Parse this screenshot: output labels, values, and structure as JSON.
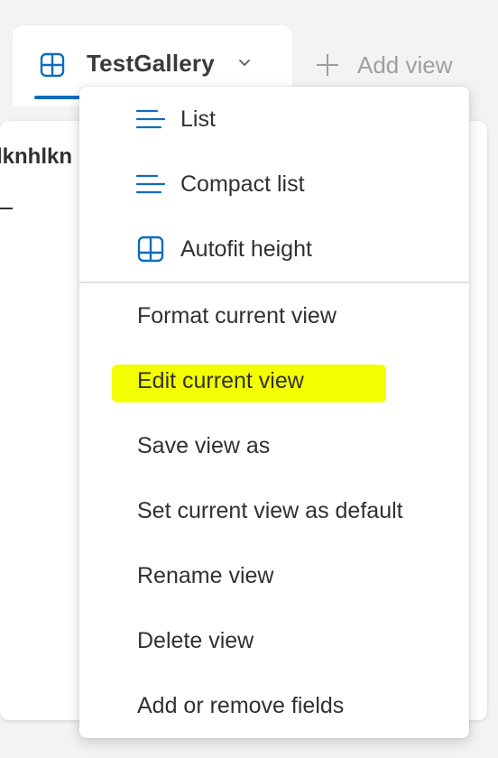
{
  "tab": {
    "title": "TestGallery",
    "icon": "grid-view-icon",
    "accent_color": "#0f6cbd"
  },
  "add_view": {
    "label": "Add view",
    "icon": "plus-icon"
  },
  "card": {
    "title_fragment": "lknhlkn"
  },
  "menu": {
    "view_types": [
      {
        "label": "List",
        "icon": "list-icon"
      },
      {
        "label": "Compact list",
        "icon": "compact-list-icon"
      },
      {
        "label": "Autofit height",
        "icon": "autofit-grid-icon"
      }
    ],
    "actions": [
      {
        "label": "Format current view"
      },
      {
        "label": "Edit current view",
        "highlighted": true,
        "highlight_color": "#f3ff00"
      },
      {
        "label": "Save view as"
      },
      {
        "label": "Set current view as default"
      },
      {
        "label": "Rename view"
      },
      {
        "label": "Delete view"
      },
      {
        "label": "Add or remove fields"
      }
    ]
  }
}
